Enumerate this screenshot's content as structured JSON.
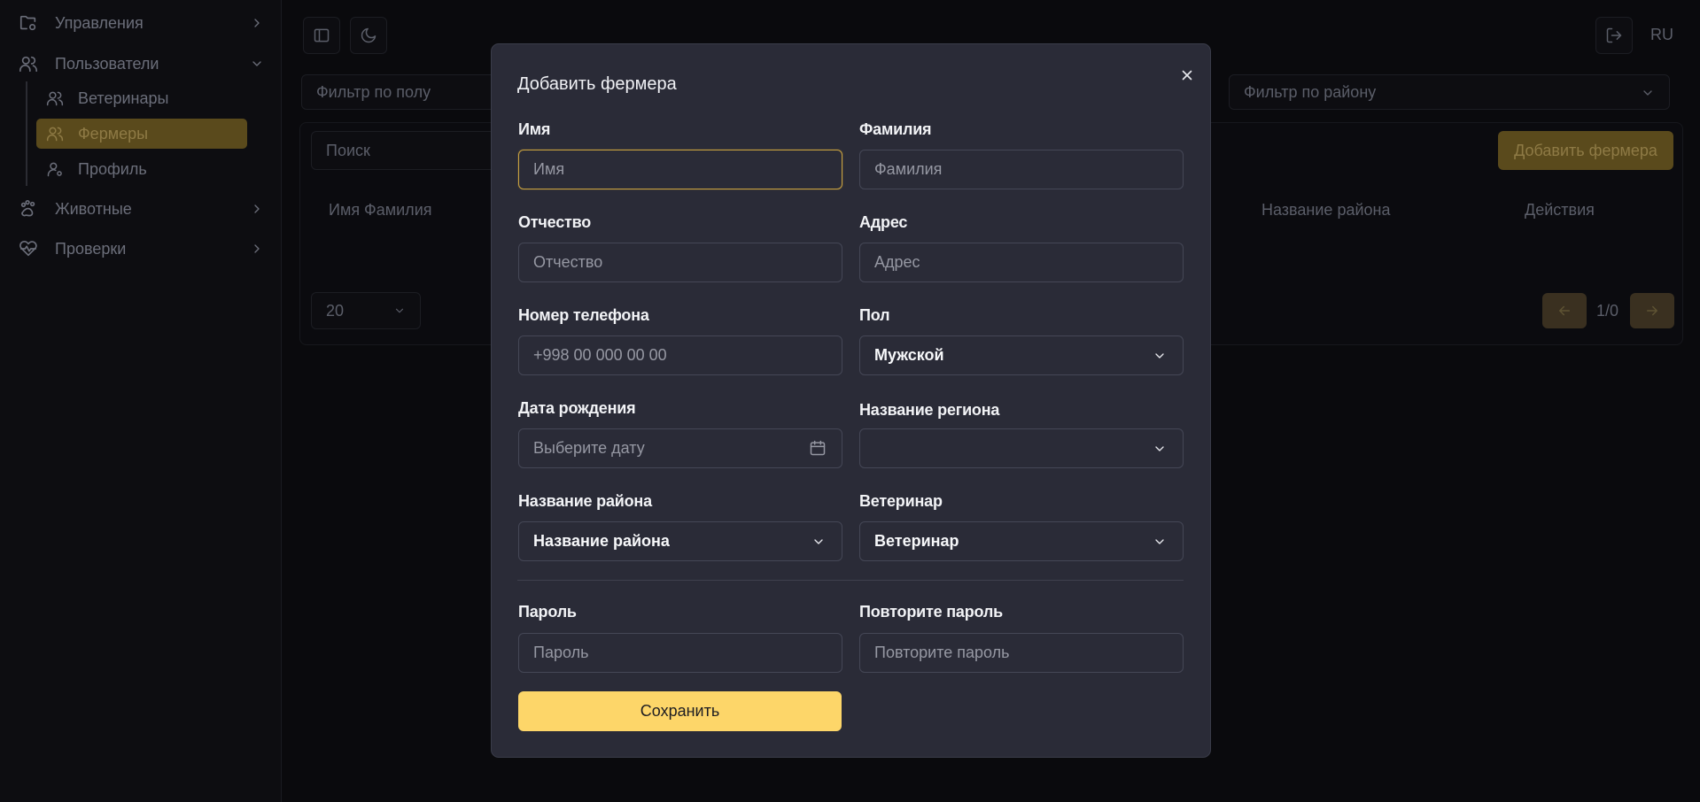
{
  "sidebar": {
    "items": [
      {
        "label": "Управления"
      },
      {
        "label": "Пользователи"
      },
      {
        "label": "Животные"
      },
      {
        "label": "Проверки"
      }
    ],
    "sub_items": [
      {
        "label": "Ветеринары"
      },
      {
        "label": "Фермеры"
      },
      {
        "label": "Профиль"
      }
    ]
  },
  "header": {
    "language": "RU"
  },
  "background": {
    "filter_gender_placeholder": "Фильтр по полу",
    "filter_district_placeholder": "Фильтр по району",
    "search_placeholder": "Поиск",
    "add_button": "Добавить фермера",
    "table_columns": [
      "Имя Фамилия",
      "Название района",
      "Действия"
    ],
    "page_size": "20",
    "pagination": "1/0"
  },
  "modal": {
    "title": "Добавить фермера",
    "fields": {
      "first_name": {
        "label": "Имя",
        "placeholder": "Имя"
      },
      "last_name": {
        "label": "Фамилия",
        "placeholder": "Фамилия"
      },
      "patronymic": {
        "label": "Отчество",
        "placeholder": "Отчество"
      },
      "address": {
        "label": "Адрес",
        "placeholder": "Адрес"
      },
      "phone": {
        "label": "Номер телефона",
        "placeholder": "+998 00 000 00 00"
      },
      "gender": {
        "label": "Пол",
        "value": "Мужской"
      },
      "birth_date": {
        "label": "Дата рождения",
        "placeholder": "Выберите дату"
      },
      "region": {
        "label": "Название региона",
        "value": ""
      },
      "district": {
        "label": "Название района",
        "value": "Название района"
      },
      "veterinarian": {
        "label": "Ветеринар",
        "value": "Ветеринар"
      },
      "password": {
        "label": "Пароль",
        "placeholder": "Пароль"
      },
      "password_confirm": {
        "label": "Повторите пароль",
        "placeholder": "Повторите пароль"
      }
    },
    "save_button": "Сохранить"
  },
  "colors": {
    "accent": "#fdd669",
    "modal_bg": "#2a2b37",
    "page_bg": "#0a0a0d",
    "focus_border": "#c9a240"
  },
  "icons": [
    "folder-settings-icon",
    "users-icon",
    "user-icon",
    "animals-icon",
    "heart-pulse-icon",
    "sidebar-toggle-icon",
    "moon-icon",
    "logout-icon",
    "close-icon",
    "calendar-icon",
    "chevron-down-icon",
    "chevron-right-icon",
    "arrow-left-icon",
    "arrow-right-icon"
  ]
}
